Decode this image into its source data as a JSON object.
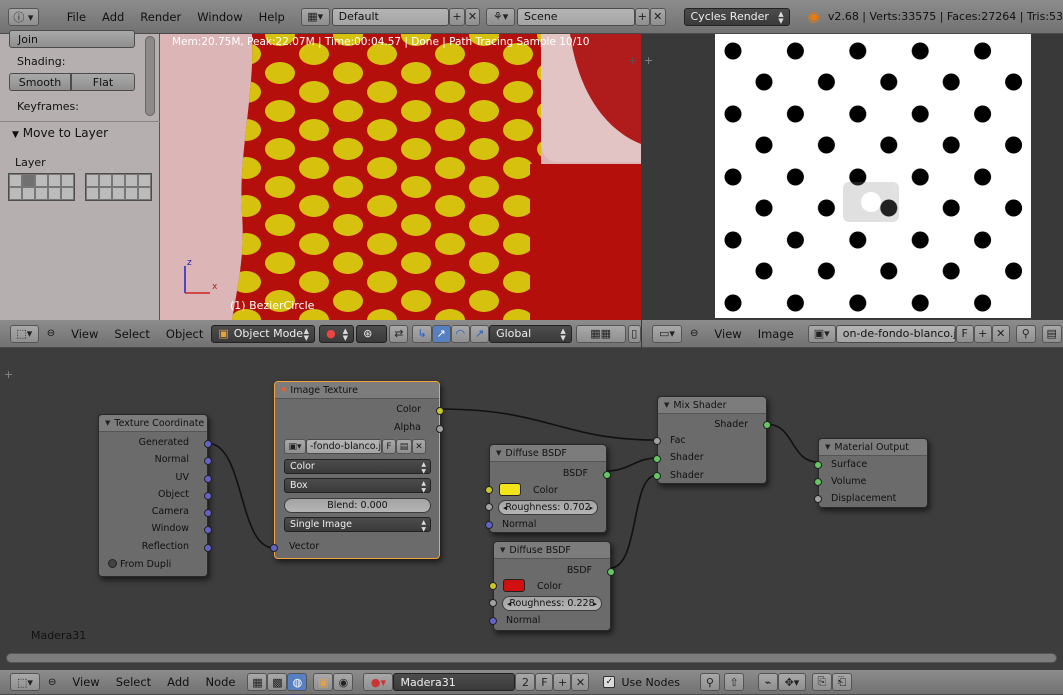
{
  "top_bar": {
    "menus": [
      "File",
      "Add",
      "Render",
      "Window",
      "Help"
    ],
    "screen_layout": "Default",
    "scene": "Scene",
    "render_engine": "Cycles Render",
    "stats": "v2.68 | Verts:33575 | Faces:27264 | Tris:53"
  },
  "tool_panel": {
    "join_label": "Join",
    "shading_label": "Shading:",
    "smooth_label": "Smooth",
    "flat_label": "Flat",
    "keyframes_label": "Keyframes:",
    "move_to_layer_label": "Move to Layer",
    "layer_label": "Layer"
  },
  "viewport": {
    "render_status": "Mem:20.75M, Peak:22.07M | Time:00:04.57 | Done | Path Tracing Sample 10/10",
    "object_label": "(1) BezierCircle",
    "axis_z": "z",
    "axis_x": "x"
  },
  "viewport_header": {
    "menus": [
      "View",
      "Select",
      "Object"
    ],
    "mode": "Object Mode",
    "orientation": "Global"
  },
  "image_editor_header": {
    "menus": [
      "View",
      "Image"
    ],
    "image_name": "on-de-fondo-blanco.jpg",
    "fake_user": "F"
  },
  "node_editor": {
    "material_label": "Madera31",
    "nodes": {
      "texture_coordinate": {
        "title": "Texture Coordinate",
        "outputs": [
          "Generated",
          "Normal",
          "UV",
          "Object",
          "Camera",
          "Window",
          "Reflection"
        ],
        "from_dupli": "From Dupli"
      },
      "image_texture": {
        "title": "Image Texture",
        "outputs": [
          "Color",
          "Alpha"
        ],
        "image": "-fondo-blanco.jpg",
        "fake_user": "F",
        "color_space": "Color",
        "projection": "Box",
        "blend": "Blend: 0.000",
        "extension": "Single Image",
        "input_vector": "Vector"
      },
      "diffuse_yellow": {
        "title": "Diffuse BSDF",
        "output": "BSDF",
        "color_label": "Color",
        "color": "#f2e31a",
        "roughness": "Roughness: 0.702",
        "normal": "Normal"
      },
      "diffuse_red": {
        "title": "Diffuse BSDF",
        "output": "BSDF",
        "color_label": "Color",
        "color": "#d01010",
        "roughness": "Roughness: 0.228",
        "normal": "Normal"
      },
      "mix_shader": {
        "title": "Mix Shader",
        "output": "Shader",
        "inputs": [
          "Fac",
          "Shader",
          "Shader"
        ]
      },
      "material_output": {
        "title": "Material Output",
        "inputs": [
          "Surface",
          "Volume",
          "Displacement"
        ]
      }
    }
  },
  "node_header": {
    "menus": [
      "View",
      "Select",
      "Add",
      "Node"
    ],
    "material": "Madera31",
    "users": "2",
    "fake_user": "F",
    "use_nodes": "Use Nodes"
  }
}
